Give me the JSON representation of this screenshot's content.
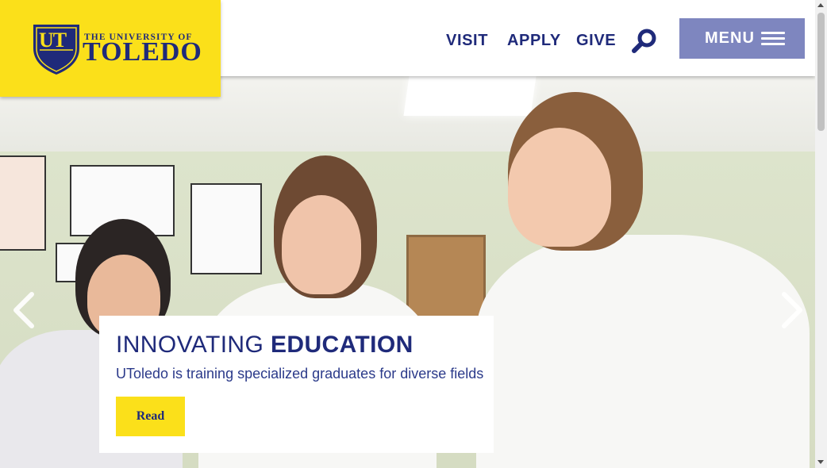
{
  "logo": {
    "monogram": "UT",
    "small_text": "THE UNIVERSITY OF",
    "big_text": "TOLEDO"
  },
  "nav": {
    "visit": "VISIT",
    "apply": "APPLY",
    "give": "GIVE",
    "menu": "MENU"
  },
  "hero": {
    "title_light": "INNOVATING",
    "title_bold": "EDUCATION",
    "subtitle": "UToledo is training specialized graduates for diverse fields",
    "button": "Read"
  },
  "colors": {
    "brand_blue": "#1f2a7a",
    "brand_gold": "#fbe01a",
    "menu_bg": "#7e86bf"
  },
  "icons": {
    "search": "search-icon",
    "menu": "hamburger-icon",
    "prev": "chevron-left-icon",
    "next": "chevron-right-icon"
  }
}
